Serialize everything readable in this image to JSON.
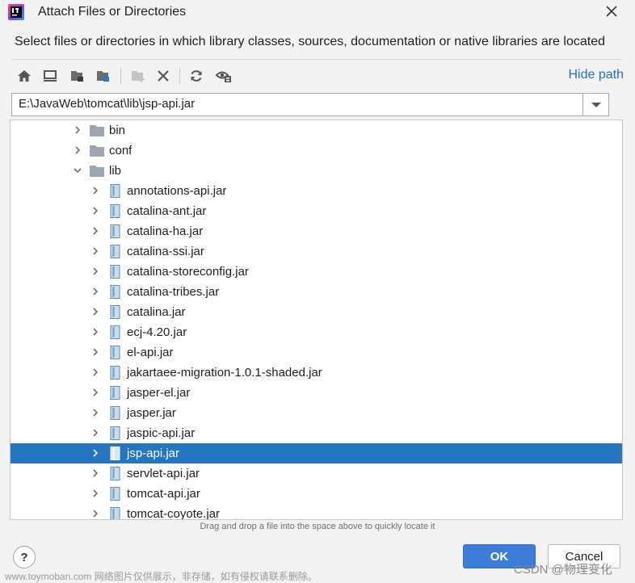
{
  "window": {
    "title": "Attach Files or Directories",
    "description": "Select files or directories in which library classes, sources, documentation or native libraries are located"
  },
  "toolbar": {
    "buttons": [
      {
        "icon": "home-icon",
        "name": "home"
      },
      {
        "icon": "desktop-icon",
        "name": "desktop"
      },
      {
        "icon": "project-folder-icon",
        "name": "project-directory"
      },
      {
        "icon": "module-folder-icon",
        "name": "module-directory"
      },
      {
        "icon": "new-folder-icon",
        "name": "new-folder",
        "enabled": false
      },
      {
        "icon": "delete-icon",
        "name": "delete"
      },
      {
        "icon": "refresh-icon",
        "name": "refresh"
      },
      {
        "icon": "show-hidden-icon",
        "name": "show-hidden"
      }
    ],
    "hide_path_label": "Hide path"
  },
  "path": {
    "value": "E:\\JavaWeb\\tomcat\\lib\\jsp-api.jar"
  },
  "tree": {
    "rows": [
      {
        "label": "bin",
        "type": "folder",
        "expanded": false,
        "depth": 0
      },
      {
        "label": "conf",
        "type": "folder",
        "expanded": false,
        "depth": 0
      },
      {
        "label": "lib",
        "type": "folder",
        "expanded": true,
        "depth": 0
      },
      {
        "label": "annotations-api.jar",
        "type": "jar",
        "depth": 1
      },
      {
        "label": "catalina-ant.jar",
        "type": "jar",
        "depth": 1
      },
      {
        "label": "catalina-ha.jar",
        "type": "jar",
        "depth": 1
      },
      {
        "label": "catalina-ssi.jar",
        "type": "jar",
        "depth": 1
      },
      {
        "label": "catalina-storeconfig.jar",
        "type": "jar",
        "depth": 1
      },
      {
        "label": "catalina-tribes.jar",
        "type": "jar",
        "depth": 1
      },
      {
        "label": "catalina.jar",
        "type": "jar",
        "depth": 1
      },
      {
        "label": "ecj-4.20.jar",
        "type": "jar",
        "depth": 1
      },
      {
        "label": "el-api.jar",
        "type": "jar",
        "depth": 1
      },
      {
        "label": "jakartaee-migration-1.0.1-shaded.jar",
        "type": "jar",
        "depth": 1
      },
      {
        "label": "jasper-el.jar",
        "type": "jar",
        "depth": 1
      },
      {
        "label": "jasper.jar",
        "type": "jar",
        "depth": 1
      },
      {
        "label": "jaspic-api.jar",
        "type": "jar",
        "depth": 1
      },
      {
        "label": "jsp-api.jar",
        "type": "jar",
        "depth": 1,
        "selected": true
      },
      {
        "label": "servlet-api.jar",
        "type": "jar",
        "depth": 1
      },
      {
        "label": "tomcat-api.jar",
        "type": "jar",
        "depth": 1
      },
      {
        "label": "tomcat-coyote.jar",
        "type": "jar",
        "depth": 1
      }
    ]
  },
  "hint": "Drag and drop a file into the space above to quickly locate it",
  "buttons": {
    "help": "?",
    "ok": "OK",
    "cancel": "Cancel"
  },
  "watermarks": {
    "left": "www.toymoban.com 网络图片仅供展示，非存储，如有侵权请联系删除。",
    "right": "CSDN @物理变化"
  },
  "colors": {
    "accent": "#2675bf",
    "link": "#2470b3",
    "ok_button": "#3b7dd8"
  }
}
